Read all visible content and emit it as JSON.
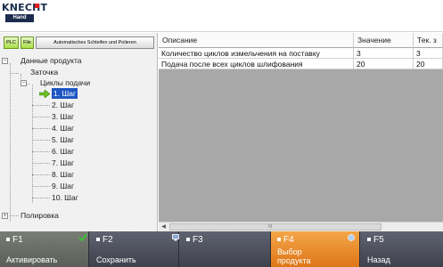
{
  "logo": {
    "brand": "KNECHT",
    "badge": "Hand"
  },
  "tabs": {
    "plc": "PLC",
    "file": "File",
    "auto": "Automatisches Schleifen und Polieren"
  },
  "tree": {
    "root": "Данные продукта",
    "sharpening": "Заточка",
    "feed_cycles": "Циклы подачи",
    "steps": [
      "1. Шаг",
      "2. Шаг",
      "3. Шаг",
      "4. Шаг",
      "5. Шаг",
      "6. Шаг",
      "7. Шаг",
      "8. Шаг",
      "9. Шаг",
      "10. Шаг"
    ],
    "selected_index": 0,
    "polishing": "Полировка"
  },
  "table": {
    "columns": [
      "Описание",
      "Значение",
      "Тек. з"
    ],
    "rows": [
      [
        "Количество циклов измельчения на поставку",
        "3",
        "3"
      ],
      [
        "Подача после всех циклов шлифования",
        "20",
        "20"
      ]
    ]
  },
  "scrollbar": {
    "grip": "III"
  },
  "fkeys": [
    {
      "key": "F1",
      "label": "Активировать"
    },
    {
      "key": "F2",
      "label": "Сохранить"
    },
    {
      "key": "F3",
      "label": ""
    },
    {
      "key": "F4",
      "label": "Выбор продукта"
    },
    {
      "key": "F5",
      "label": "Назад"
    }
  ],
  "colors": {
    "accent_orange": "#dd7616",
    "selection_blue": "#1e56c2",
    "brand_red": "#e01d1d",
    "ok_green": "#3ac13a"
  },
  "icons": {
    "f1_status": "check-icon",
    "f3_status": "display-icon",
    "f4_status": "globe-icon",
    "tree_pointer": "arrow-right-icon"
  }
}
